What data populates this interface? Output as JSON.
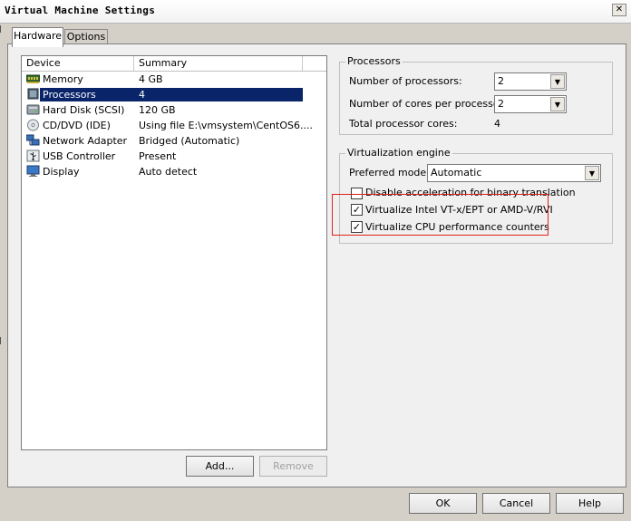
{
  "window": {
    "title": "Virtual Machine Settings",
    "close_glyph": "✕"
  },
  "tabs": [
    {
      "label": "Hardware",
      "active": true
    },
    {
      "label": "Options",
      "active": false
    }
  ],
  "device_list": {
    "columns": [
      "Device",
      "Summary"
    ],
    "rows": [
      {
        "device": "Memory",
        "summary": "4 GB",
        "icon": "memory-icon",
        "selected": false
      },
      {
        "device": "Processors",
        "summary": "4",
        "icon": "processor-icon",
        "selected": true
      },
      {
        "device": "Hard Disk (SCSI)",
        "summary": "120 GB",
        "icon": "hard-disk-icon",
        "selected": false
      },
      {
        "device": "CD/DVD (IDE)",
        "summary": "Using file E:\\vmsystem\\CentOS6....",
        "icon": "cd-dvd-icon",
        "selected": false
      },
      {
        "device": "Network Adapter",
        "summary": "Bridged (Automatic)",
        "icon": "network-adapter-icon",
        "selected": false
      },
      {
        "device": "USB Controller",
        "summary": "Present",
        "icon": "usb-icon",
        "selected": false
      },
      {
        "device": "Display",
        "summary": "Auto detect",
        "icon": "display-icon",
        "selected": false
      }
    ],
    "add_label": "Add...",
    "remove_label": "Remove"
  },
  "processors": {
    "group_label": "Processors",
    "num_processors_label": "Number of processors:",
    "num_processors_value": "2",
    "cores_label": "Number of cores per processor:",
    "cores_value": "2",
    "total_label": "Total processor cores:",
    "total_value": "4"
  },
  "virtualization": {
    "group_label": "Virtualization engine",
    "mode_label": "Preferred mode:",
    "mode_value": "Automatic",
    "options": [
      {
        "label": "Disable acceleration for binary translation",
        "checked": false
      },
      {
        "label": "Virtualize Intel VT-x/EPT or AMD-V/RVI",
        "checked": true
      },
      {
        "label": "Virtualize CPU performance counters",
        "checked": true
      }
    ]
  },
  "footer": {
    "ok_label": "OK",
    "cancel_label": "Cancel",
    "help_label": "Help"
  },
  "colors": {
    "selection": "#0a246a",
    "annotation_box": "#e0201a",
    "dialog_bg": "#d4d0c8"
  }
}
